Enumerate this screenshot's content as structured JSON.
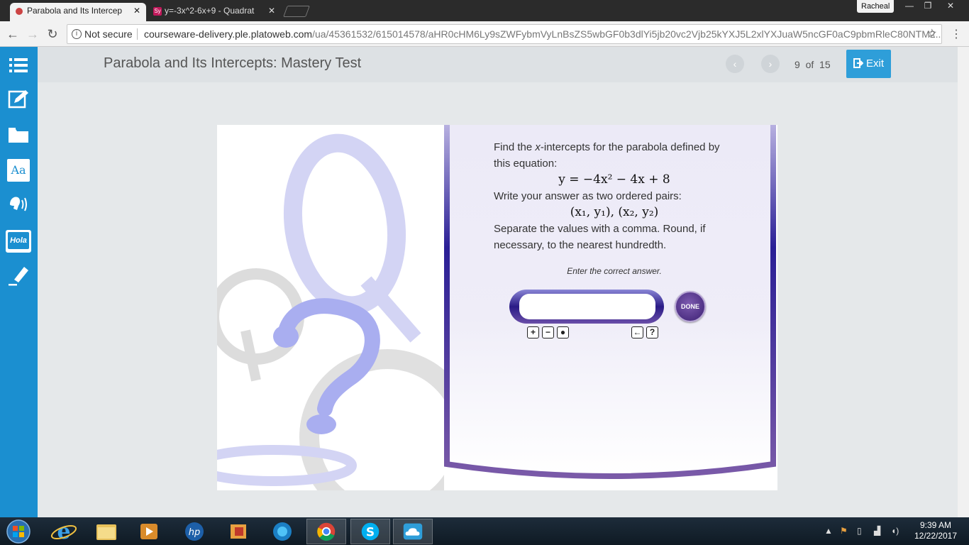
{
  "browser": {
    "tabs": [
      {
        "title": "Parabola and Its Intercep",
        "active": true
      },
      {
        "title": "y=-3x^2-6x+9 - Quadrat",
        "favicon_text": "Sy",
        "active": false
      }
    ],
    "user": "Racheal",
    "security_label": "Not secure",
    "url_host": "courseware-delivery.ple.platoweb.com",
    "url_path": "/ua/45361532/615014578/aHR0cHM6Ly9sZWFybmVyLnBsZS5wbGF0b3dlYi5jb20vc2Vjb25kYXJ5L2xlYXJuaW5ncGF0aC9pbmRleC80NTM2..."
  },
  "app": {
    "title": "Parabola and Its Intercepts: Mastery Test",
    "page_current": "9",
    "page_of": "of",
    "page_total": "15",
    "exit_label": "Exit",
    "sidebar_icons": [
      "list-icon",
      "edit-icon",
      "folder-icon",
      "dictionary-icon",
      "speaker-icon",
      "translate-icon",
      "highlighter-icon"
    ],
    "sidebar_badges": {
      "dictionary": "Aa",
      "translate": "Hola"
    },
    "accent_color": "#1b8fd0"
  },
  "question": {
    "line1_a": "Find the ",
    "line1_var": "x",
    "line1_b": "-intercepts for the parabola defined by this equation:",
    "equation": "y = −4x² − 4x + 8",
    "line2": "Write your answer as two ordered pairs:",
    "pairs": "(x₁, y₁), (x₂, y₂)",
    "line3": "Separate the values with a comma. Round, if necessary, to the nearest hundredth.",
    "instruction": "Enter the correct answer.",
    "answer_value": "",
    "done_label": "DONE",
    "tools": [
      "+",
      "−",
      "●",
      "←",
      "?"
    ]
  },
  "taskbar": {
    "time": "9:39 AM",
    "date": "12/22/2017"
  }
}
